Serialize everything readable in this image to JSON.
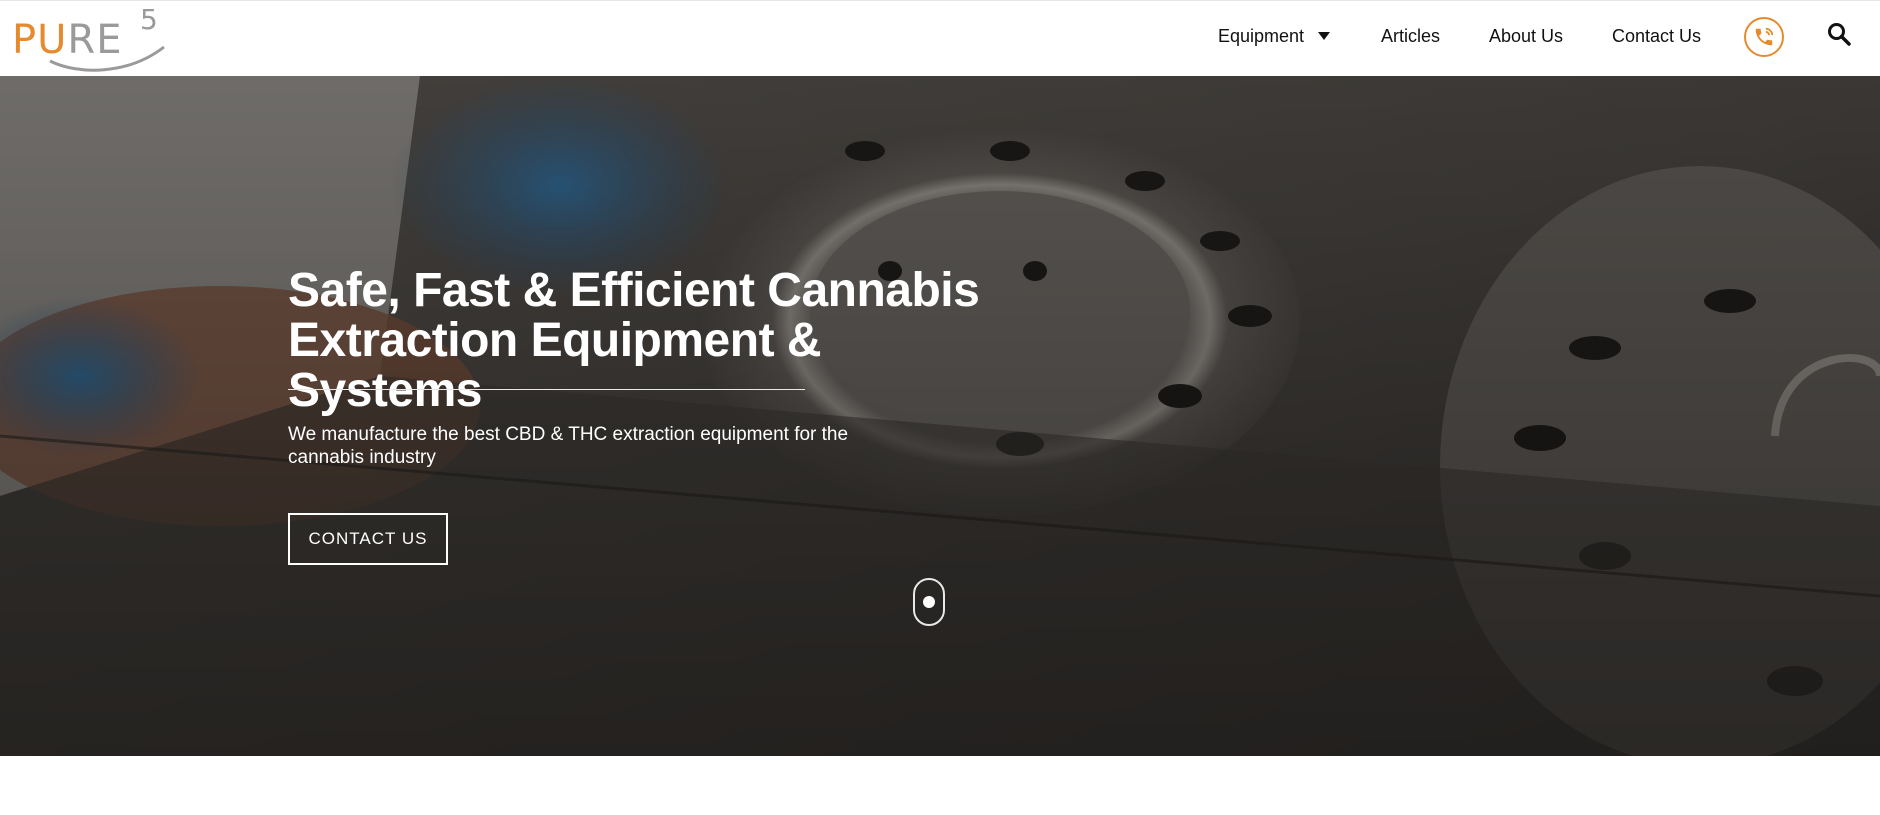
{
  "brand": {
    "logo_main_a": "PU",
    "logo_main_b": "RE",
    "logo_superscript": "5",
    "accent_color": "#e68a2e",
    "gray_color": "#9a9a9a"
  },
  "nav": {
    "items": [
      {
        "label": "Equipment",
        "has_dropdown": true
      },
      {
        "label": "Articles"
      },
      {
        "label": "About Us"
      },
      {
        "label": "Contact Us"
      }
    ],
    "phone_icon": "phone-icon",
    "search_icon": "search-icon"
  },
  "hero": {
    "title_line1": "Safe, Fast & Efficient Cannabis",
    "title_line2": "Extraction Equipment & Systems",
    "subtitle": "We manufacture the best CBD & THC extraction equipment for the cannabis industry",
    "cta_label": "CONTACT US",
    "scroll_icon": "scroll-down-icon"
  }
}
